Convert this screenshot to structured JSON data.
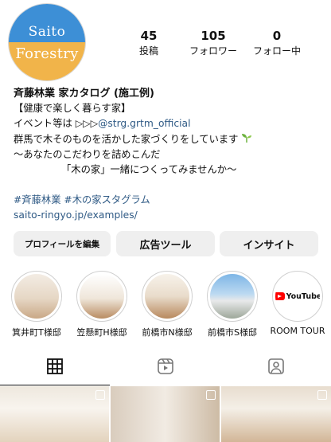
{
  "profile": {
    "avatar_line1": "Saito",
    "avatar_line2": "Forestry",
    "stats": [
      {
        "value": "45",
        "label": "投稿"
      },
      {
        "value": "105",
        "label": "フォロワー"
      },
      {
        "value": "0",
        "label": "フォロー中"
      }
    ],
    "name": "斉藤林業 家カタログ (施工例)",
    "bio": {
      "line1": "【健康で楽しく暮らす家】",
      "line2_prefix": "イベント等は ▷▷▷",
      "line2_link": "@strg.grtm_official",
      "line3": "群馬で木そのものを活かした家づくりをしています",
      "line4": "～あなたのこだわりを詰めこんだ",
      "line5": "「木の家」一緒につくってみませんか～",
      "hashtags": "#斉藤林業 #木の家スタグラム",
      "url": "saito-ringyo.jp/examples/"
    }
  },
  "buttons": {
    "edit_profile": "プロフィールを編集",
    "ad_tools": "広告ツール",
    "insights": "インサイト"
  },
  "highlights": [
    {
      "label": "箕井町T様邸"
    },
    {
      "label": "笠懸町H様邸"
    },
    {
      "label": "前橋市N様邸"
    },
    {
      "label": "前橋市S様邸"
    },
    {
      "label": "ROOM TOUR",
      "logo_text": "YouTube"
    }
  ],
  "tabs": [
    {
      "icon": "grid-icon"
    },
    {
      "icon": "reels-icon"
    },
    {
      "icon": "tagged-icon"
    }
  ],
  "colors": {
    "link": "#2f5a85",
    "avatar_top": "#3d8fd6",
    "avatar_bottom": "#f1b44a",
    "button_bg": "#efefef"
  }
}
